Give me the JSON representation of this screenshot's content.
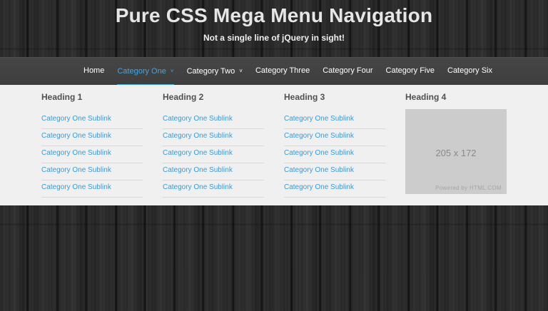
{
  "header": {
    "title": "Pure CSS Mega Menu Navigation",
    "subtitle": "Not a single line of jQuery in sight!"
  },
  "nav": {
    "items": [
      {
        "label": "Home"
      },
      {
        "label": "Category One",
        "caret": "˅"
      },
      {
        "label": "Category Two",
        "caret": "˅"
      },
      {
        "label": "Category Three"
      },
      {
        "label": "Category Four"
      },
      {
        "label": "Category Five"
      },
      {
        "label": "Category Six"
      }
    ],
    "active_color": "#3fa7e4"
  },
  "mega_menu": {
    "columns": [
      {
        "heading": "Heading 1",
        "links": [
          "Category One Sublink",
          "Category One Sublink",
          "Category One Sublink",
          "Category One Sublink",
          "Category One Sublink"
        ]
      },
      {
        "heading": "Heading 2",
        "links": [
          "Category One Sublink",
          "Category One Sublink",
          "Category One Sublink",
          "Category One Sublink",
          "Category One Sublink"
        ]
      },
      {
        "heading": "Heading 3",
        "links": [
          "Category One Sublink",
          "Category One Sublink",
          "Category One Sublink",
          "Category One Sublink",
          "Category One Sublink"
        ]
      },
      {
        "heading": "Heading 4",
        "image": {
          "dimensions_text": "205 x 172",
          "powered_text": "Powered by HTML.COM"
        }
      }
    ],
    "link_color": "#3a9ad9"
  }
}
